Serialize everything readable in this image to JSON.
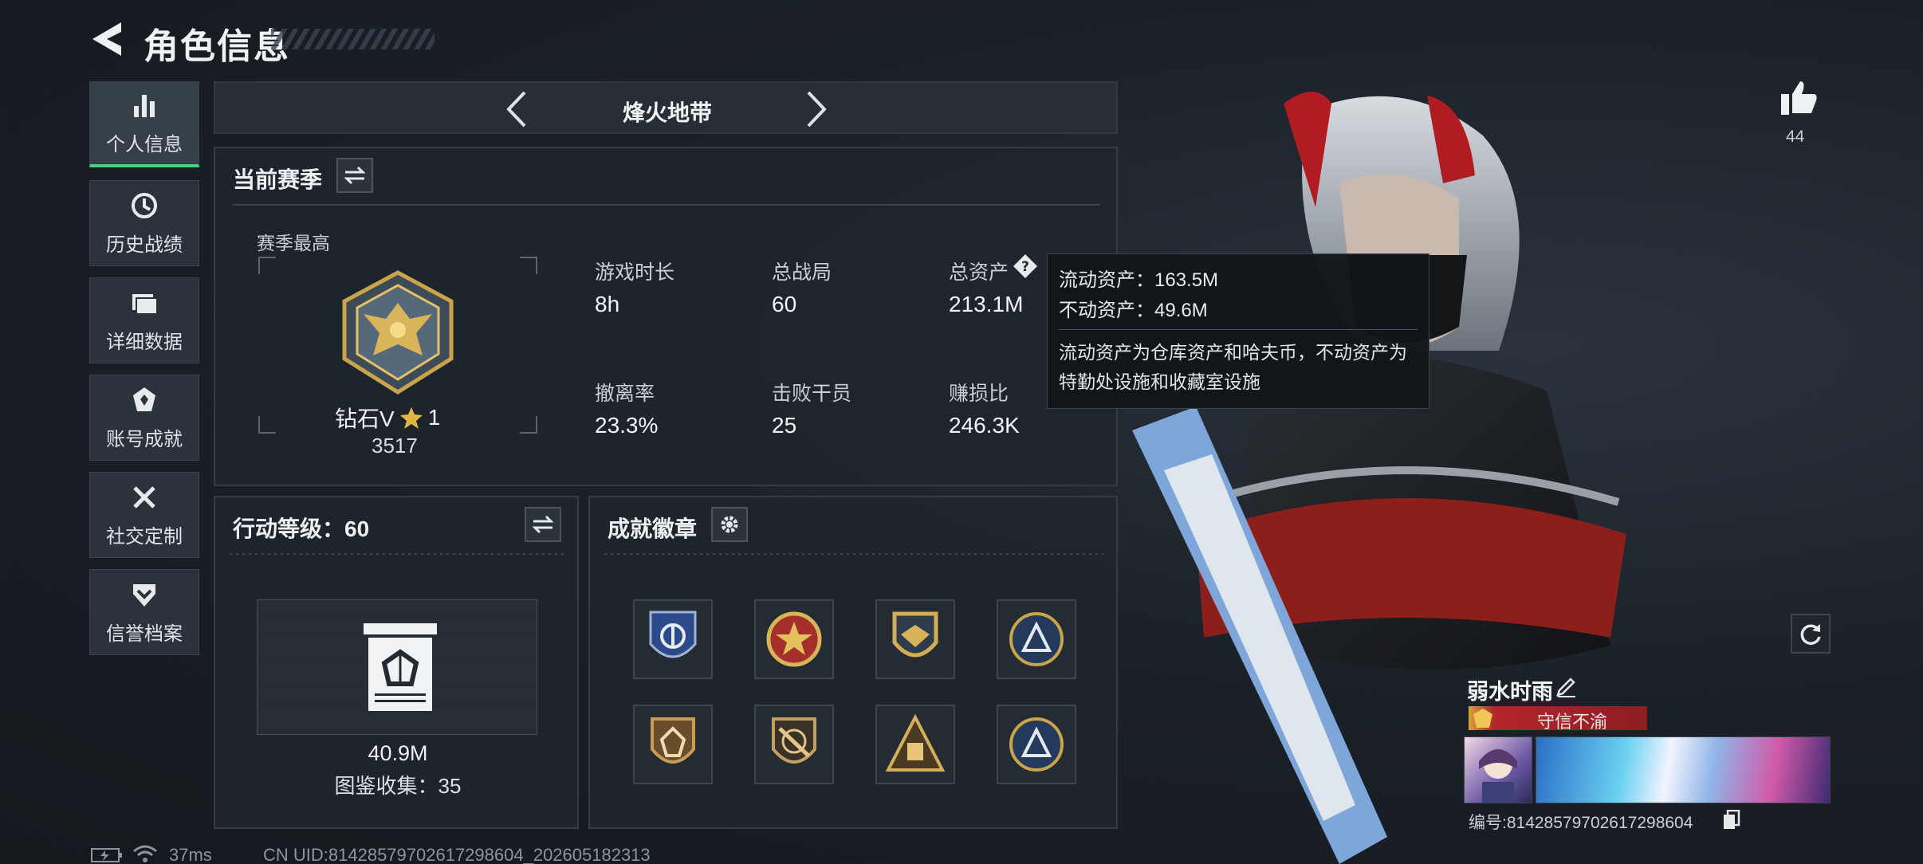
{
  "header": {
    "title": "角色信息"
  },
  "sidebar": {
    "items": [
      {
        "label": "个人信息",
        "icon": "bar-chart-icon",
        "active": true
      },
      {
        "label": "历史战绩",
        "icon": "history-clock-icon",
        "active": false
      },
      {
        "label": "详细数据",
        "icon": "folder-icon",
        "active": false
      },
      {
        "label": "账号成就",
        "icon": "achievement-icon",
        "active": false
      },
      {
        "label": "社交定制",
        "icon": "tools-icon",
        "active": false
      },
      {
        "label": "信誉档案",
        "icon": "shield-chevron-icon",
        "active": false
      }
    ]
  },
  "mode": {
    "name": "烽火地带"
  },
  "season": {
    "title": "当前赛季",
    "best_label": "赛季最高",
    "rank_name": "钻石V",
    "rank_stars": "1",
    "rank_score": "3517",
    "stats": [
      {
        "label": "游戏时长",
        "value": "8h"
      },
      {
        "label": "总战局",
        "value": "60"
      },
      {
        "label": "总资产",
        "value": "213.1M"
      },
      {
        "label": "撤离率",
        "value": "23.3%"
      },
      {
        "label": "击败干员",
        "value": "25"
      },
      {
        "label": "赚损比",
        "value": "246.3K"
      }
    ]
  },
  "tooltip": {
    "liquid": "流动资产：163.5M",
    "fixed": "不动资产：49.6M",
    "desc": "流动资产为仓库资产和哈夫币，不动资产为特勤处设施和收藏室设施"
  },
  "action_level": {
    "title": "行动等级：60",
    "value": "40.9M",
    "collection": "图鉴收集：35"
  },
  "badges": {
    "title": "成就徽章",
    "items": [
      "blue-shield-badge",
      "red-star-badge",
      "gold-wing-badge",
      "blue-round-badge",
      "bronze-shield-badge",
      "rifle-badge",
      "pyramid-badge",
      "blue-round-badge-2"
    ]
  },
  "likes": {
    "count": "44"
  },
  "player": {
    "name": "弱水时雨",
    "reputation": "守信不渝",
    "id_line": "编号:81428579702617298604"
  },
  "status_bar": {
    "ping": "37ms",
    "uid": "CN UID:81428579702617298604_202605182313"
  },
  "colors": {
    "accent_green": "#3fd57a",
    "rank_gold": "#c9a44a",
    "reputation_red": "#b3262b"
  }
}
